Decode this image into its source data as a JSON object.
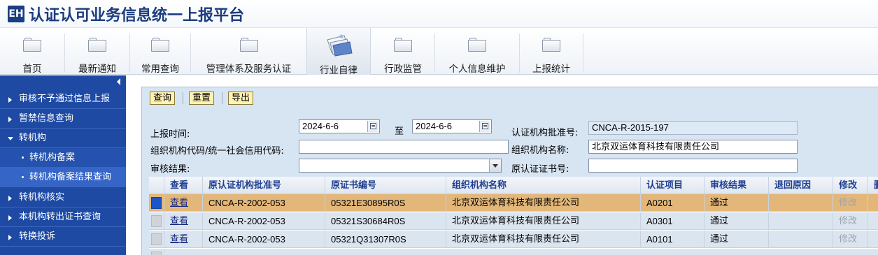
{
  "app": {
    "logo_text": "EH",
    "title": "认证认可业务信息统一上报平台"
  },
  "topnav": {
    "items": [
      {
        "label": "首页",
        "icon": "folder-icon"
      },
      {
        "label": "最新通知",
        "icon": "folder-icon"
      },
      {
        "label": "常用查询",
        "icon": "folder-icon"
      },
      {
        "label": "管理体系及服务认证",
        "icon": "folder-icon"
      },
      {
        "label": "行业自律",
        "icon": "documents-icon",
        "active": true
      },
      {
        "label": "行政监管",
        "icon": "folder-icon"
      },
      {
        "label": "个人信息维护",
        "icon": "folder-icon"
      },
      {
        "label": "上报统计",
        "icon": "folder-icon"
      }
    ]
  },
  "sidebar": {
    "items": [
      {
        "label": "审核不予通过信息上报"
      },
      {
        "label": "暂禁信息查询"
      },
      {
        "label": "转机构",
        "expanded": true
      },
      {
        "label": "转机构备案"
      },
      {
        "label": "转机构备案结果查询",
        "selected": true
      },
      {
        "label": "转机构核实"
      },
      {
        "label": "本机构转出证书查询"
      },
      {
        "label": "转换投诉"
      }
    ]
  },
  "toolbar": {
    "query": "查询",
    "reset": "重置",
    "export": "导出"
  },
  "form": {
    "report_time_label": "上报时间:",
    "date_from": "2024-6-6",
    "to_label": "至",
    "date_to": "2024-6-6",
    "approval_no_label": "认证机构批准号:",
    "approval_no_value": "CNCA-R-2015-197",
    "org_code_label": "组织机构代码/统一社会信用代码:",
    "org_code_value": "",
    "org_name_label": "组织机构名称:",
    "org_name_value": "北京双运体育科技有限责任公司",
    "audit_result_label": "审核结果:",
    "audit_result_value": "",
    "orig_cert_label": "原认证证书号:",
    "orig_cert_value": ""
  },
  "table": {
    "columns": [
      "查看",
      "原认证机构批准号",
      "原证书编号",
      "组织机构名称",
      "认证项目",
      "审核结果",
      "退回原因",
      "修改",
      "删"
    ],
    "rows": [
      {
        "view": "查看",
        "orig_approval": "CNCA-R-2002-053",
        "orig_cert": "05321E30895R0S",
        "org": "北京双运体育科技有限责任公司",
        "project": "A0201",
        "result": "通过",
        "reason": "",
        "edit": "修改",
        "selected": true
      },
      {
        "view": "查看",
        "orig_approval": "CNCA-R-2002-053",
        "orig_cert": "05321S30684R0S",
        "org": "北京双运体育科技有限责任公司",
        "project": "A0301",
        "result": "通过",
        "reason": "",
        "edit": "修改"
      },
      {
        "view": "查看",
        "orig_approval": "CNCA-R-2002-053",
        "orig_cert": "05321Q31307R0S",
        "org": "北京双运体育科技有限责任公司",
        "project": "A0101",
        "result": "通过",
        "reason": "",
        "edit": "修改"
      }
    ]
  },
  "colors": {
    "sidebar_bg": "#1e4aa4",
    "title_color": "#1c3c7f",
    "selected_row": "#e3b77a",
    "panel_bg": "#d7e4f2",
    "header_text": "#1f3f92"
  }
}
